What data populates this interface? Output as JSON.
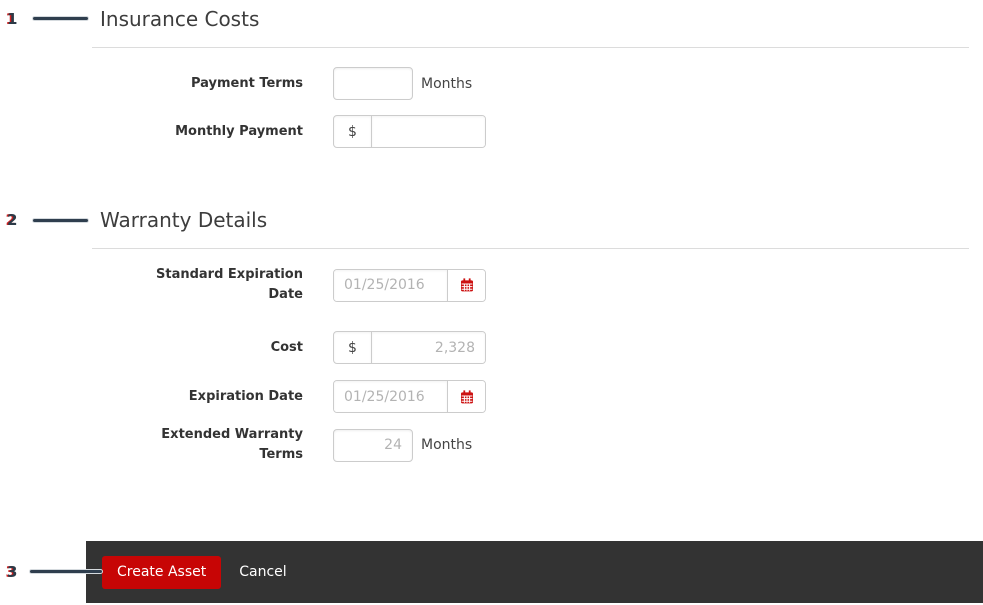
{
  "annotations": [
    {
      "number": "1",
      "target": "insurance-costs-section"
    },
    {
      "number": "2",
      "target": "warranty-details-section"
    },
    {
      "number": "3",
      "target": "create-asset-button"
    }
  ],
  "sections": [
    {
      "title": "Insurance Costs",
      "fields": [
        {
          "label": "Payment Terms",
          "value": "",
          "suffix": "Months"
        },
        {
          "label": "Monthly Payment",
          "prefix": "$",
          "value": ""
        }
      ]
    },
    {
      "title": "Warranty Details",
      "fields": [
        {
          "label": "Standard Expiration Date",
          "placeholder": "01/25/2016",
          "icon": "calendar-icon"
        },
        {
          "label": "Cost",
          "prefix": "$",
          "placeholder": "2,328"
        },
        {
          "label": "Expiration Date",
          "placeholder": "01/25/2016",
          "icon": "calendar-icon"
        },
        {
          "label": "Extended Warranty Terms",
          "placeholder": "24",
          "suffix": "Months"
        }
      ]
    }
  ],
  "footer": {
    "create_label": "Create Asset",
    "cancel_label": "Cancel"
  },
  "colors": {
    "accent_red": "#c70505",
    "footer_bar": "#333333",
    "annotation_ink": "#2c3a47",
    "divider": "#dcdcdc",
    "input_border": "#cccccc",
    "placeholder_text": "#b3b3b3"
  }
}
